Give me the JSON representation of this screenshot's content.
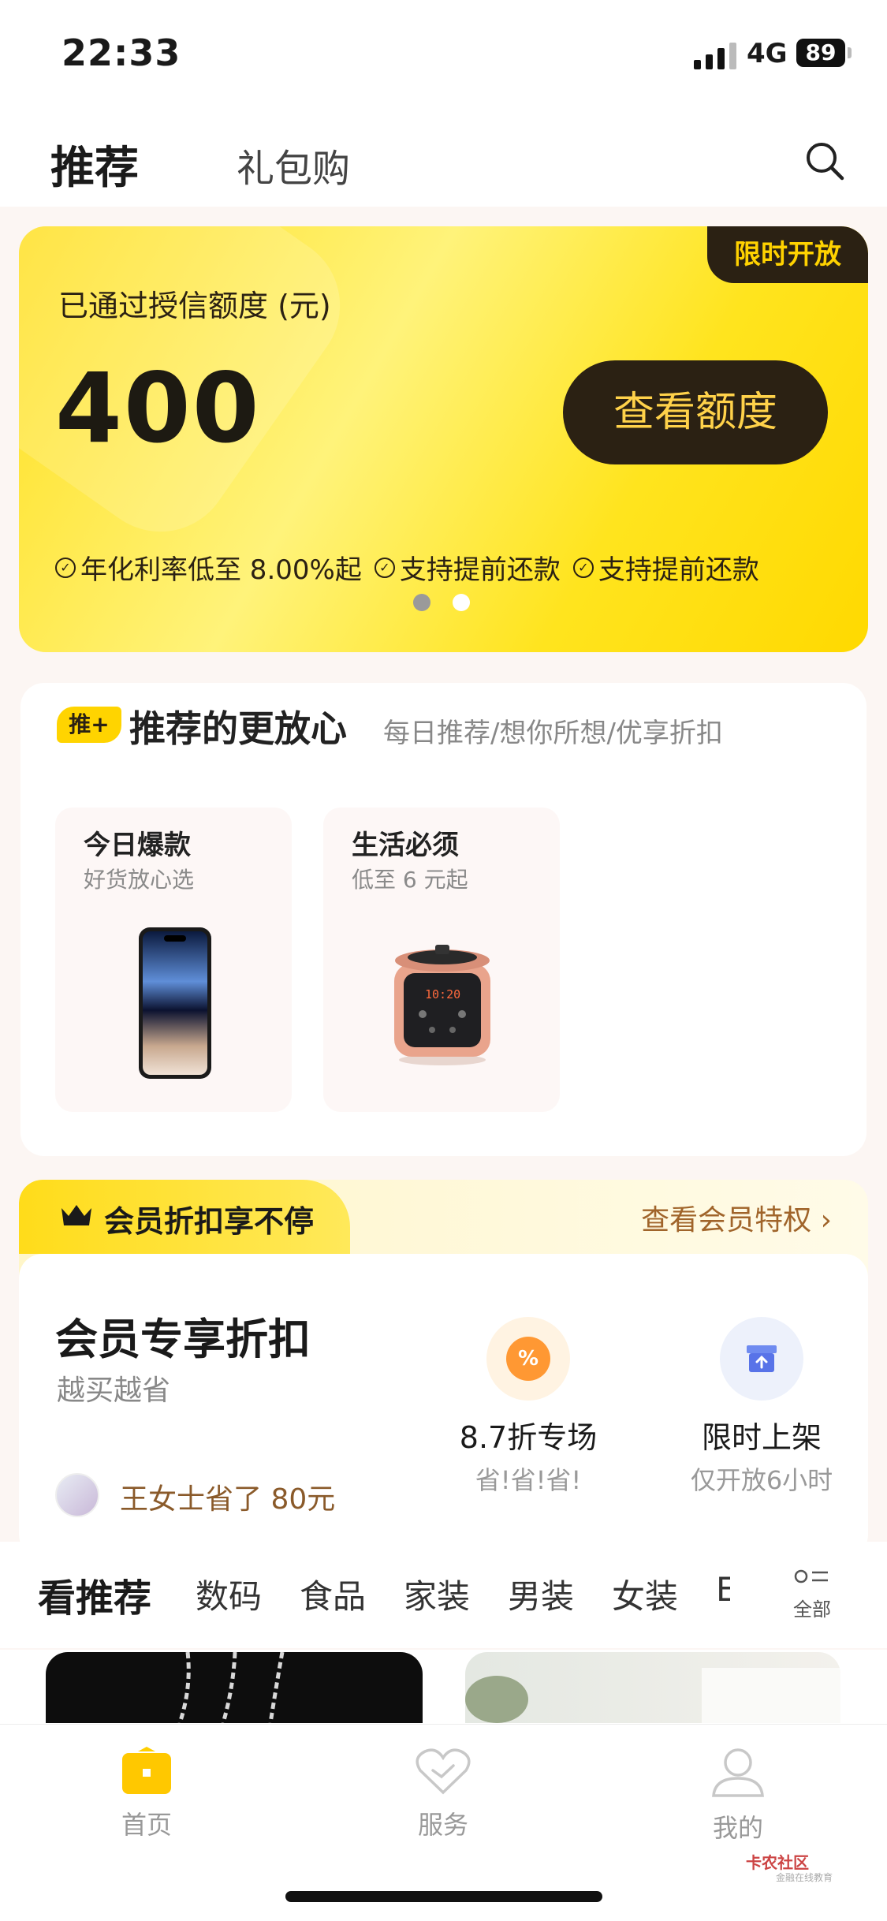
{
  "status_bar": {
    "time": "22:33",
    "network": "4G",
    "battery": "89"
  },
  "header": {
    "tab_active": "推荐",
    "tab_inactive": "礼包购"
  },
  "banner": {
    "tag": "限时开放",
    "label": "已通过授信额度 (元)",
    "amount": "400",
    "button": "查看额度",
    "features": [
      "年化利率低至 8.00%起",
      "支持提前还款",
      "支持提前还款"
    ],
    "page_count": 2,
    "active_page": 1
  },
  "recommend": {
    "badge": "推+",
    "title": "推荐的更放心",
    "subtitle": "每日推荐/想你所想/优享折扣",
    "products": [
      {
        "title": "今日爆款",
        "subtitle": "好货放心选",
        "image": "smartphone"
      },
      {
        "title": "生活必须",
        "subtitle": "低至 6 元起",
        "image": "pressure-cooker",
        "display": "10:20"
      }
    ]
  },
  "member": {
    "tab_label": "会员折扣享不停",
    "more_link": "查看会员特权",
    "title": "会员专享折扣",
    "subtitle": "越买越省",
    "saved_text": "王女士省了 80元",
    "features": [
      {
        "title": "8.7折专场",
        "subtitle": "省!省!省!",
        "icon": "percent-icon",
        "icon_text": "%"
      },
      {
        "title": "限时上架",
        "subtitle": "仅开放6小时",
        "icon": "shelf-box-icon"
      }
    ]
  },
  "categories": {
    "items": [
      "看推荐",
      "数码",
      "食品",
      "家装",
      "男装",
      "女装",
      "E"
    ],
    "active_index": 0,
    "all_label": "全部"
  },
  "bottom_nav": {
    "items": [
      {
        "label": "首页",
        "icon": "home-wallet-icon",
        "active": true
      },
      {
        "label": "服务",
        "icon": "heart-icon",
        "active": false
      },
      {
        "label": "我的",
        "icon": "user-icon",
        "active": false
      }
    ]
  },
  "watermark": {
    "title": "卡农社区",
    "subtitle": "金融在线教育"
  },
  "colors": {
    "accent_yellow": "#ffd400",
    "dark_brown": "#2b2113",
    "gold_text": "#ffd24a",
    "member_link": "#a0642a"
  }
}
